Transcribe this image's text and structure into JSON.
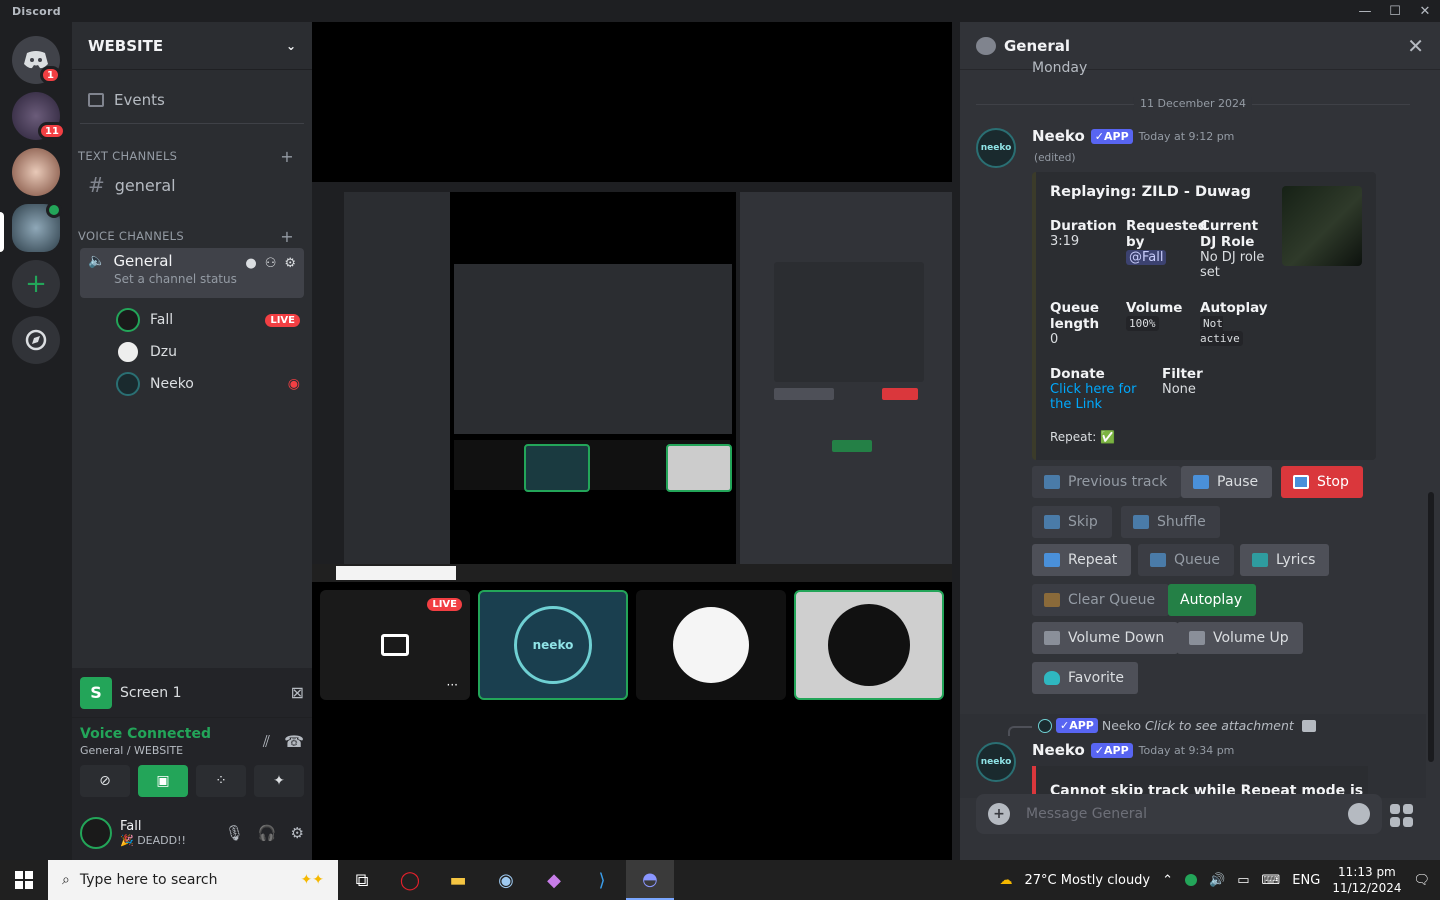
{
  "titlebar": {
    "app_name": "Discord",
    "minimize": "—",
    "maximize": "☐",
    "close": "✕"
  },
  "rail": {
    "home_badge": "1",
    "server2_badge": "11"
  },
  "sidebar": {
    "guild_name": "WEBSITE",
    "events_label": "Events",
    "text_category": "TEXT CHANNELS",
    "text_channel": "general",
    "voice_category": "VOICE CHANNELS",
    "voice_channel": "General",
    "voice_status_placeholder": "Set a channel status",
    "voice_users": [
      {
        "name": "Fall",
        "live": "LIVE"
      },
      {
        "name": "Dzu"
      },
      {
        "name": "Neeko"
      }
    ]
  },
  "screen_panel": {
    "name": "Screen 1",
    "avatar_letter": "S"
  },
  "voice_panel": {
    "status": "Voice Connected",
    "location": "General / WEBSITE"
  },
  "user_panel": {
    "name": "Fall",
    "status": "🎉 DEADD!!"
  },
  "stage": {
    "live_label": "LIVE",
    "tile_dots": "···"
  },
  "chat": {
    "header_title": "General",
    "prev_day_text": "Monday",
    "date_divider": "11 December 2024",
    "message1": {
      "author": "Neeko",
      "app_tag": "✓APP",
      "time": "Today at 9:12 pm",
      "edited": "(edited)",
      "embed": {
        "title": "Replaying: ZILD - Duwag",
        "fields": [
          {
            "title": "Duration",
            "value": "3:19"
          },
          {
            "title": "Requested by",
            "value": "@Fall"
          },
          {
            "title": "Current DJ Role",
            "value": "No DJ role set"
          },
          {
            "title": "Queue length",
            "value": "0"
          },
          {
            "title": "Volume",
            "value": "100%"
          },
          {
            "title": "Autoplay",
            "value": "Not active"
          },
          {
            "title": "Donate",
            "value": "Click here for the Link"
          },
          {
            "title": "Filter",
            "value": "None"
          }
        ],
        "repeat_label": "Repeat:",
        "repeat_value": "✅"
      },
      "buttons": [
        {
          "label": "Previous track",
          "style": "dim"
        },
        {
          "label": "Pause",
          "style": "grey"
        },
        {
          "label": "Stop",
          "style": "red"
        },
        {
          "label": "Skip",
          "style": "dim"
        },
        {
          "label": "Shuffle",
          "style": "dim"
        },
        {
          "label": "Repeat",
          "style": "grey"
        },
        {
          "label": "Queue",
          "style": "dim"
        },
        {
          "label": "Lyrics",
          "style": "grey"
        },
        {
          "label": "Clear Queue",
          "style": "dim"
        },
        {
          "label": "Autoplay",
          "style": "green"
        },
        {
          "label": "Volume Down",
          "style": "grey"
        },
        {
          "label": "Volume Up",
          "style": "grey"
        },
        {
          "label": "Favorite",
          "style": "grey"
        }
      ]
    },
    "reply": {
      "author": "Neeko",
      "text": "Click to see attachment"
    },
    "message2": {
      "author": "Neeko",
      "app_tag": "✓APP",
      "time": "Today at 9:34 pm",
      "embed_text": "Cannot skip track while Repeat mode is on"
    },
    "input_placeholder": "Message General"
  },
  "taskbar": {
    "search_placeholder": "Type here to search",
    "weather": "27°C  Mostly cloudy",
    "weather_badge": "1",
    "language": "ENG",
    "time": "11:13 pm",
    "date": "11/12/2024"
  },
  "colors": {
    "accent": "#5865f2",
    "green": "#23a559",
    "red": "#da373c",
    "link": "#00a8fc"
  }
}
